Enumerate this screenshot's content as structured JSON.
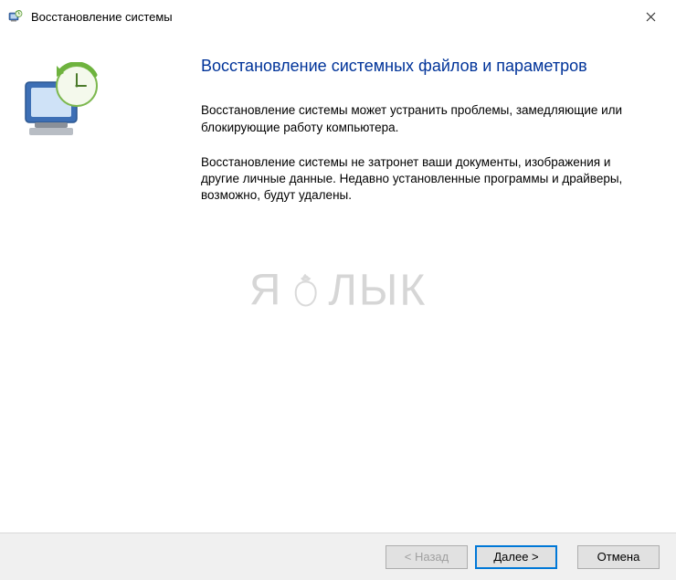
{
  "window": {
    "title": "Восстановление системы"
  },
  "content": {
    "heading": "Восстановление системных файлов и параметров",
    "paragraph1": "Восстановление системы может устранить проблемы, замедляющие или блокирующие работу компьютера.",
    "paragraph2": "Восстановление системы не затронет ваши документы, изображения и другие личные данные. Недавно установленные программы и драйверы, возможно, будут удалены."
  },
  "watermark": {
    "text_left": "Я",
    "text_right": "ЛЫК"
  },
  "buttons": {
    "back": "< Назад",
    "next": "Далее >",
    "cancel": "Отмена"
  }
}
